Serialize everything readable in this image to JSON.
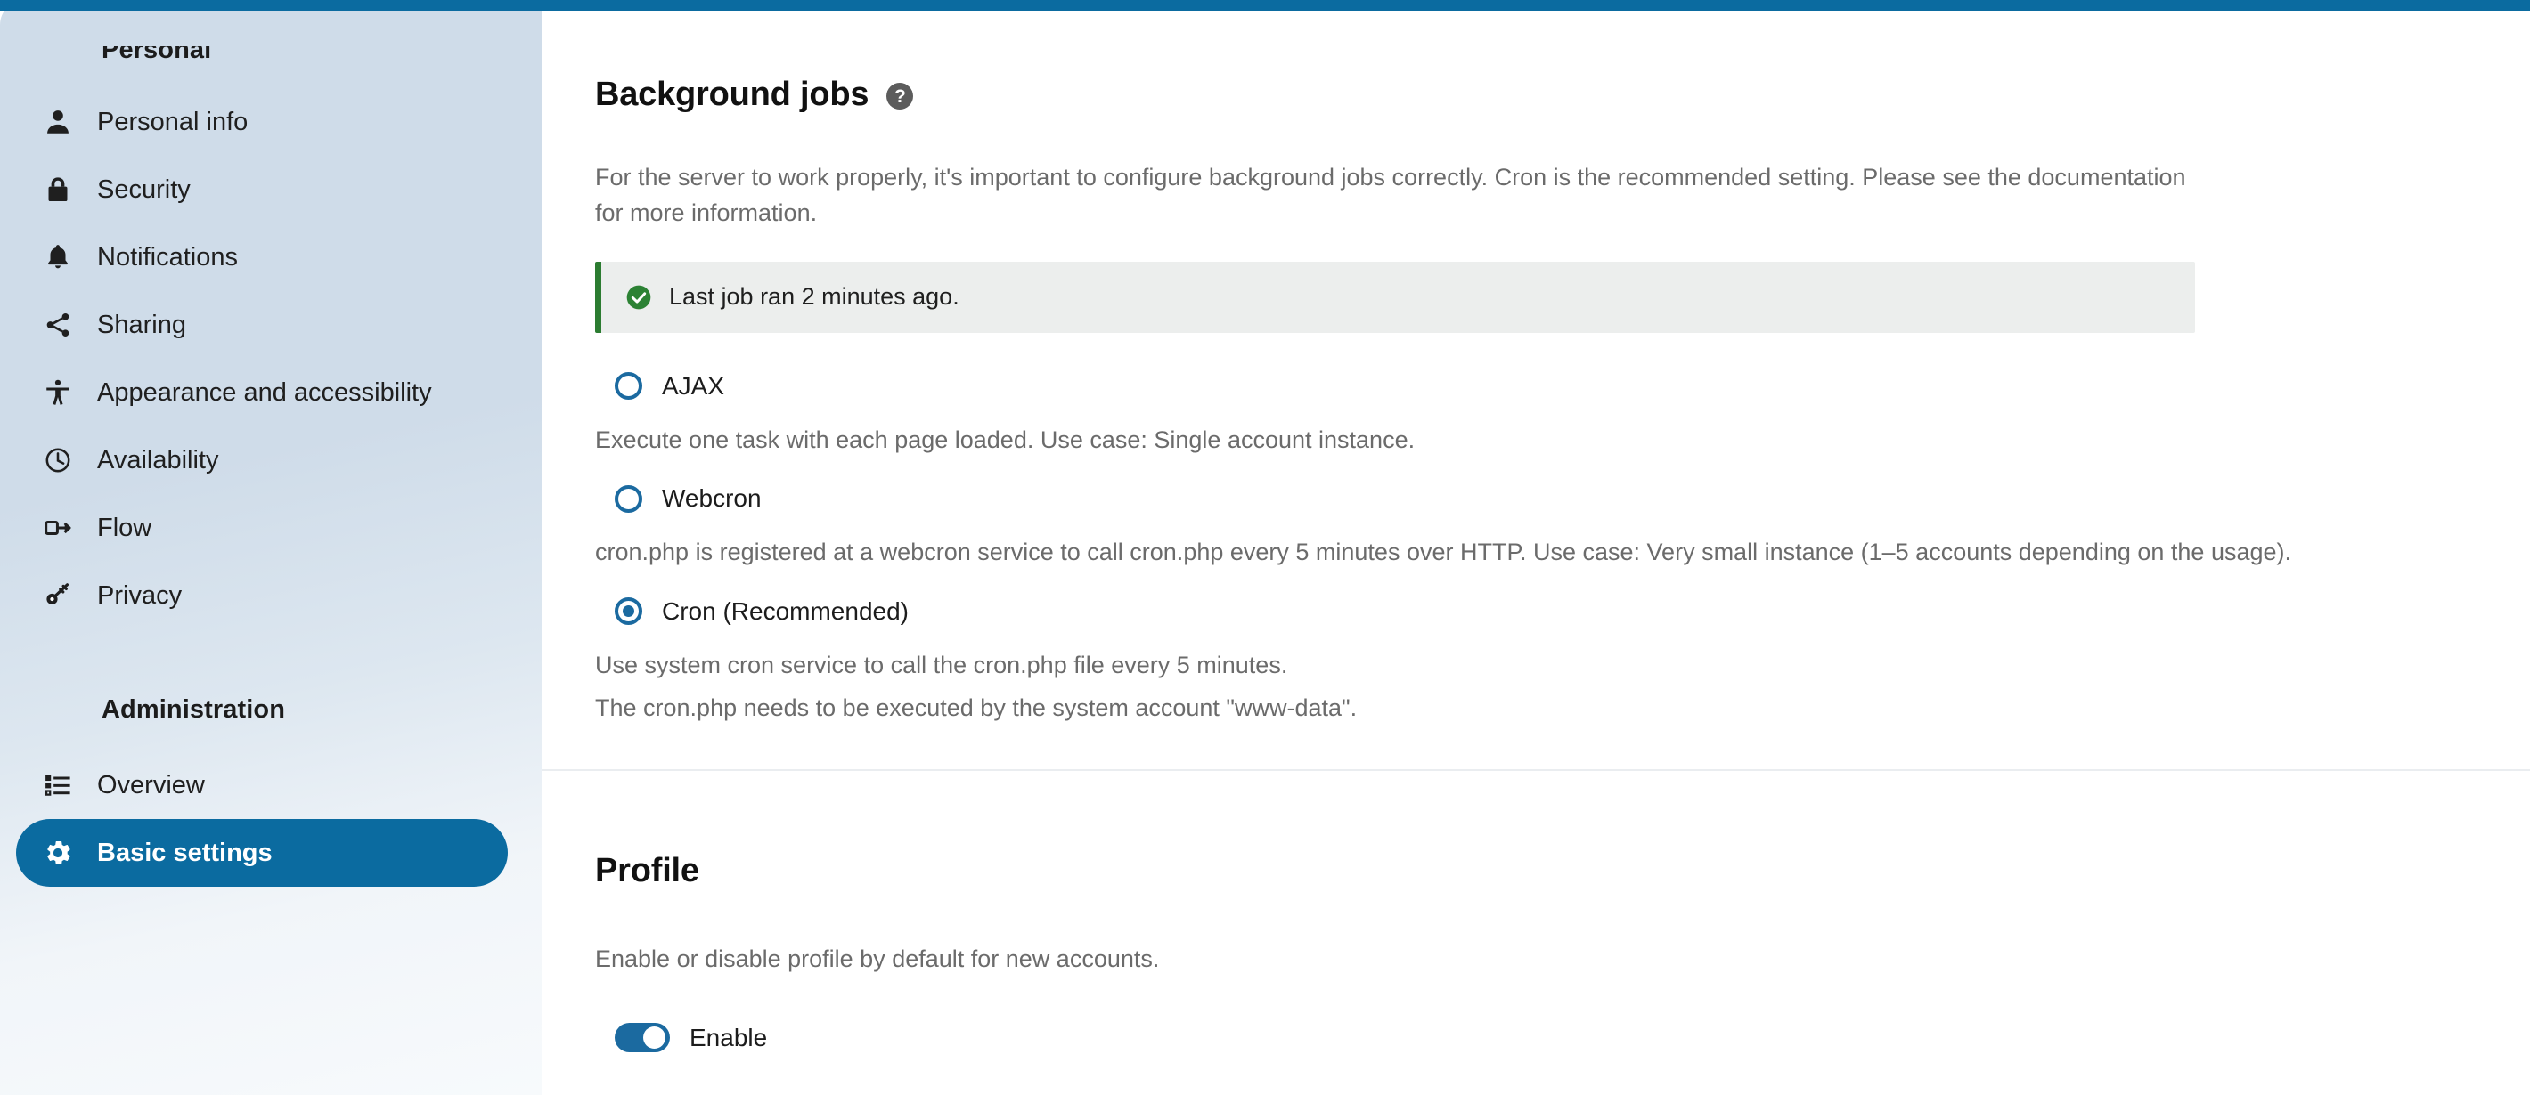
{
  "theme": {
    "accent": "#0b6ba0",
    "accent_control": "#1b6aa0",
    "sidebar_top": "#cfdce9",
    "sidebar_bottom": "#f7fafc",
    "banner_bg": "#eceeed",
    "banner_border": "#2c7c31",
    "body_text": "#1c1c1c",
    "muted_text": "#6b6b6b",
    "divider": "#eaedf0"
  },
  "sidebar": {
    "sections": [
      {
        "title": "Personal",
        "items": [
          {
            "label": "Personal info",
            "icon": "user-icon",
            "active": false
          },
          {
            "label": "Security",
            "icon": "lock-icon",
            "active": false
          },
          {
            "label": "Notifications",
            "icon": "bell-icon",
            "active": false
          },
          {
            "label": "Sharing",
            "icon": "share-icon",
            "active": false
          },
          {
            "label": "Appearance and accessibility",
            "icon": "accessibility-icon",
            "active": false
          },
          {
            "label": "Availability",
            "icon": "clock-icon",
            "active": false
          },
          {
            "label": "Flow",
            "icon": "flow-exit-icon",
            "active": false
          },
          {
            "label": "Privacy",
            "icon": "key-icon",
            "active": false
          }
        ]
      },
      {
        "title": "Administration",
        "items": [
          {
            "label": "Overview",
            "icon": "checklist-icon",
            "active": false
          },
          {
            "label": "Basic settings",
            "icon": "gear-icon",
            "active": true
          }
        ]
      }
    ]
  },
  "main": {
    "background_jobs": {
      "heading": "Background jobs",
      "help_icon_glyph": "?",
      "description": "For the server to work properly, it's important to configure background jobs correctly. Cron is the recommended setting. Please see the documentation for more information.",
      "status": {
        "icon": "check-circle-icon",
        "text": "Last job ran 2 minutes ago."
      },
      "options": [
        {
          "label": "AJAX",
          "selected": false,
          "help": "Execute one task with each page loaded. Use case: Single account instance."
        },
        {
          "label": "Webcron",
          "selected": false,
          "help": "cron.php is registered at a webcron service to call cron.php every 5 minutes over HTTP. Use case: Very small instance (1–5 accounts depending on the usage)."
        },
        {
          "label": "Cron (Recommended)",
          "selected": true,
          "help": "Use system cron service to call the cron.php file every 5 minutes.",
          "help2": "The cron.php needs to be executed by the system account \"www-data\"."
        }
      ]
    },
    "profile": {
      "heading": "Profile",
      "description": "Enable or disable profile by default for new accounts.",
      "toggle": {
        "label": "Enable",
        "enabled": true
      }
    }
  }
}
